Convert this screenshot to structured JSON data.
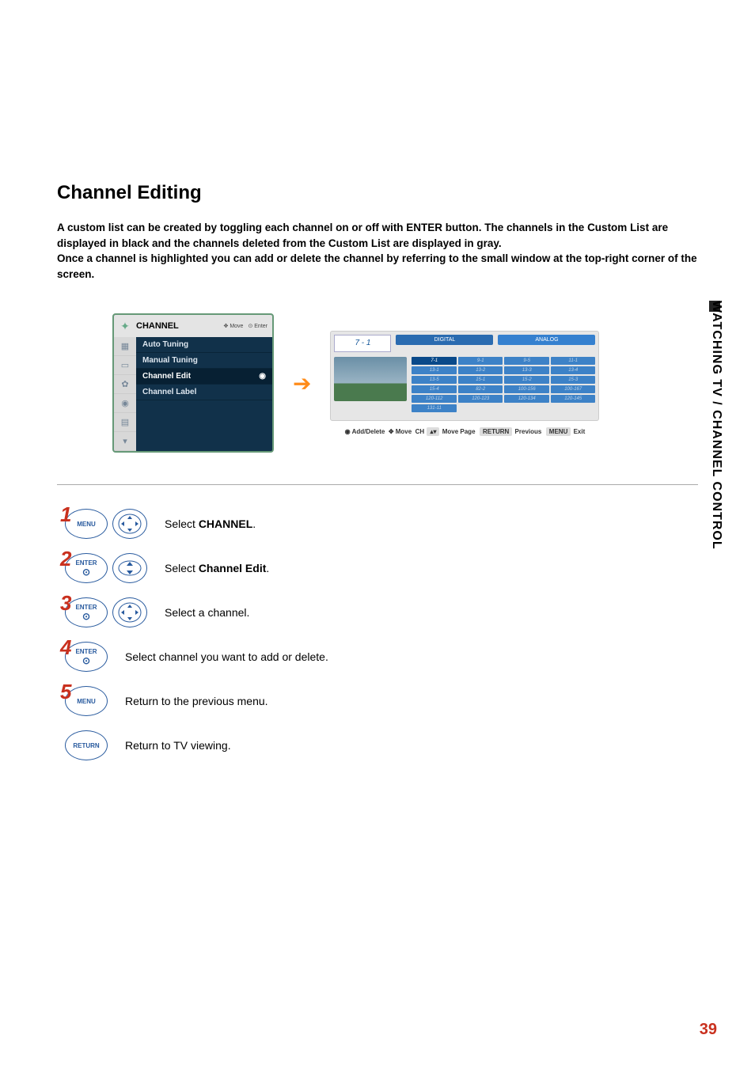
{
  "side_label": "WATCHING TV / CHANNEL CONTROL",
  "title": "Channel Editing",
  "intro": "A custom list can be created by toggling each channel on or off with ENTER button. The channels in the Custom List are displayed in black and the channels deleted from the Custom List are displayed in gray.\nOnce a channel is highlighted you can add or delete the channel by referring to the small window at the top-right corner of the screen.",
  "menu": {
    "title": "CHANNEL",
    "hint_move": "Move",
    "hint_enter": "Enter",
    "items": [
      "Auto Tuning",
      "Manual Tuning",
      "Channel Edit",
      "Channel Label"
    ],
    "selected_index": 2
  },
  "chan": {
    "current": "7 - 1",
    "tab_digital": "DIGITAL",
    "tab_analog": "ANALOG",
    "cells": [
      "7-1",
      "9-1",
      "9-5",
      "11-1",
      "13-1",
      "13-2",
      "13-3",
      "13-4",
      "13-5",
      "15-1",
      "15-2",
      "15-3",
      "15-4",
      "82-2",
      "100-156",
      "100-167",
      "120-112",
      "120-123",
      "120-134",
      "120-145",
      "131-11"
    ],
    "footer": {
      "adddel": "Add/Delete",
      "move": "Move",
      "ch": "CH",
      "movepage": "Move Page",
      "return": "RETURN",
      "previous": "Previous",
      "menu": "MENU",
      "exit": "Exit"
    }
  },
  "steps": [
    {
      "n": "1",
      "btn": "MENU",
      "nav": "cross",
      "pre": "Select ",
      "strong": "CHANNEL",
      "post": "."
    },
    {
      "n": "2",
      "btn": "ENTER",
      "nav": "updown",
      "pre": "Select ",
      "strong": "Channel Edit",
      "post": "."
    },
    {
      "n": "3",
      "btn": "ENTER",
      "nav": "cross",
      "pre": "Select a channel.",
      "strong": "",
      "post": ""
    },
    {
      "n": "4",
      "btn": "ENTER",
      "nav": "",
      "pre": "Select channel you want to add or delete.",
      "strong": "",
      "post": ""
    },
    {
      "n": "5",
      "btn": "MENU",
      "nav": "",
      "pre": "Return to the previous menu.",
      "strong": "",
      "post": ""
    },
    {
      "n": "",
      "btn": "RETURN",
      "nav": "",
      "pre": "Return to TV viewing.",
      "strong": "",
      "post": ""
    }
  ],
  "page_number": "39"
}
